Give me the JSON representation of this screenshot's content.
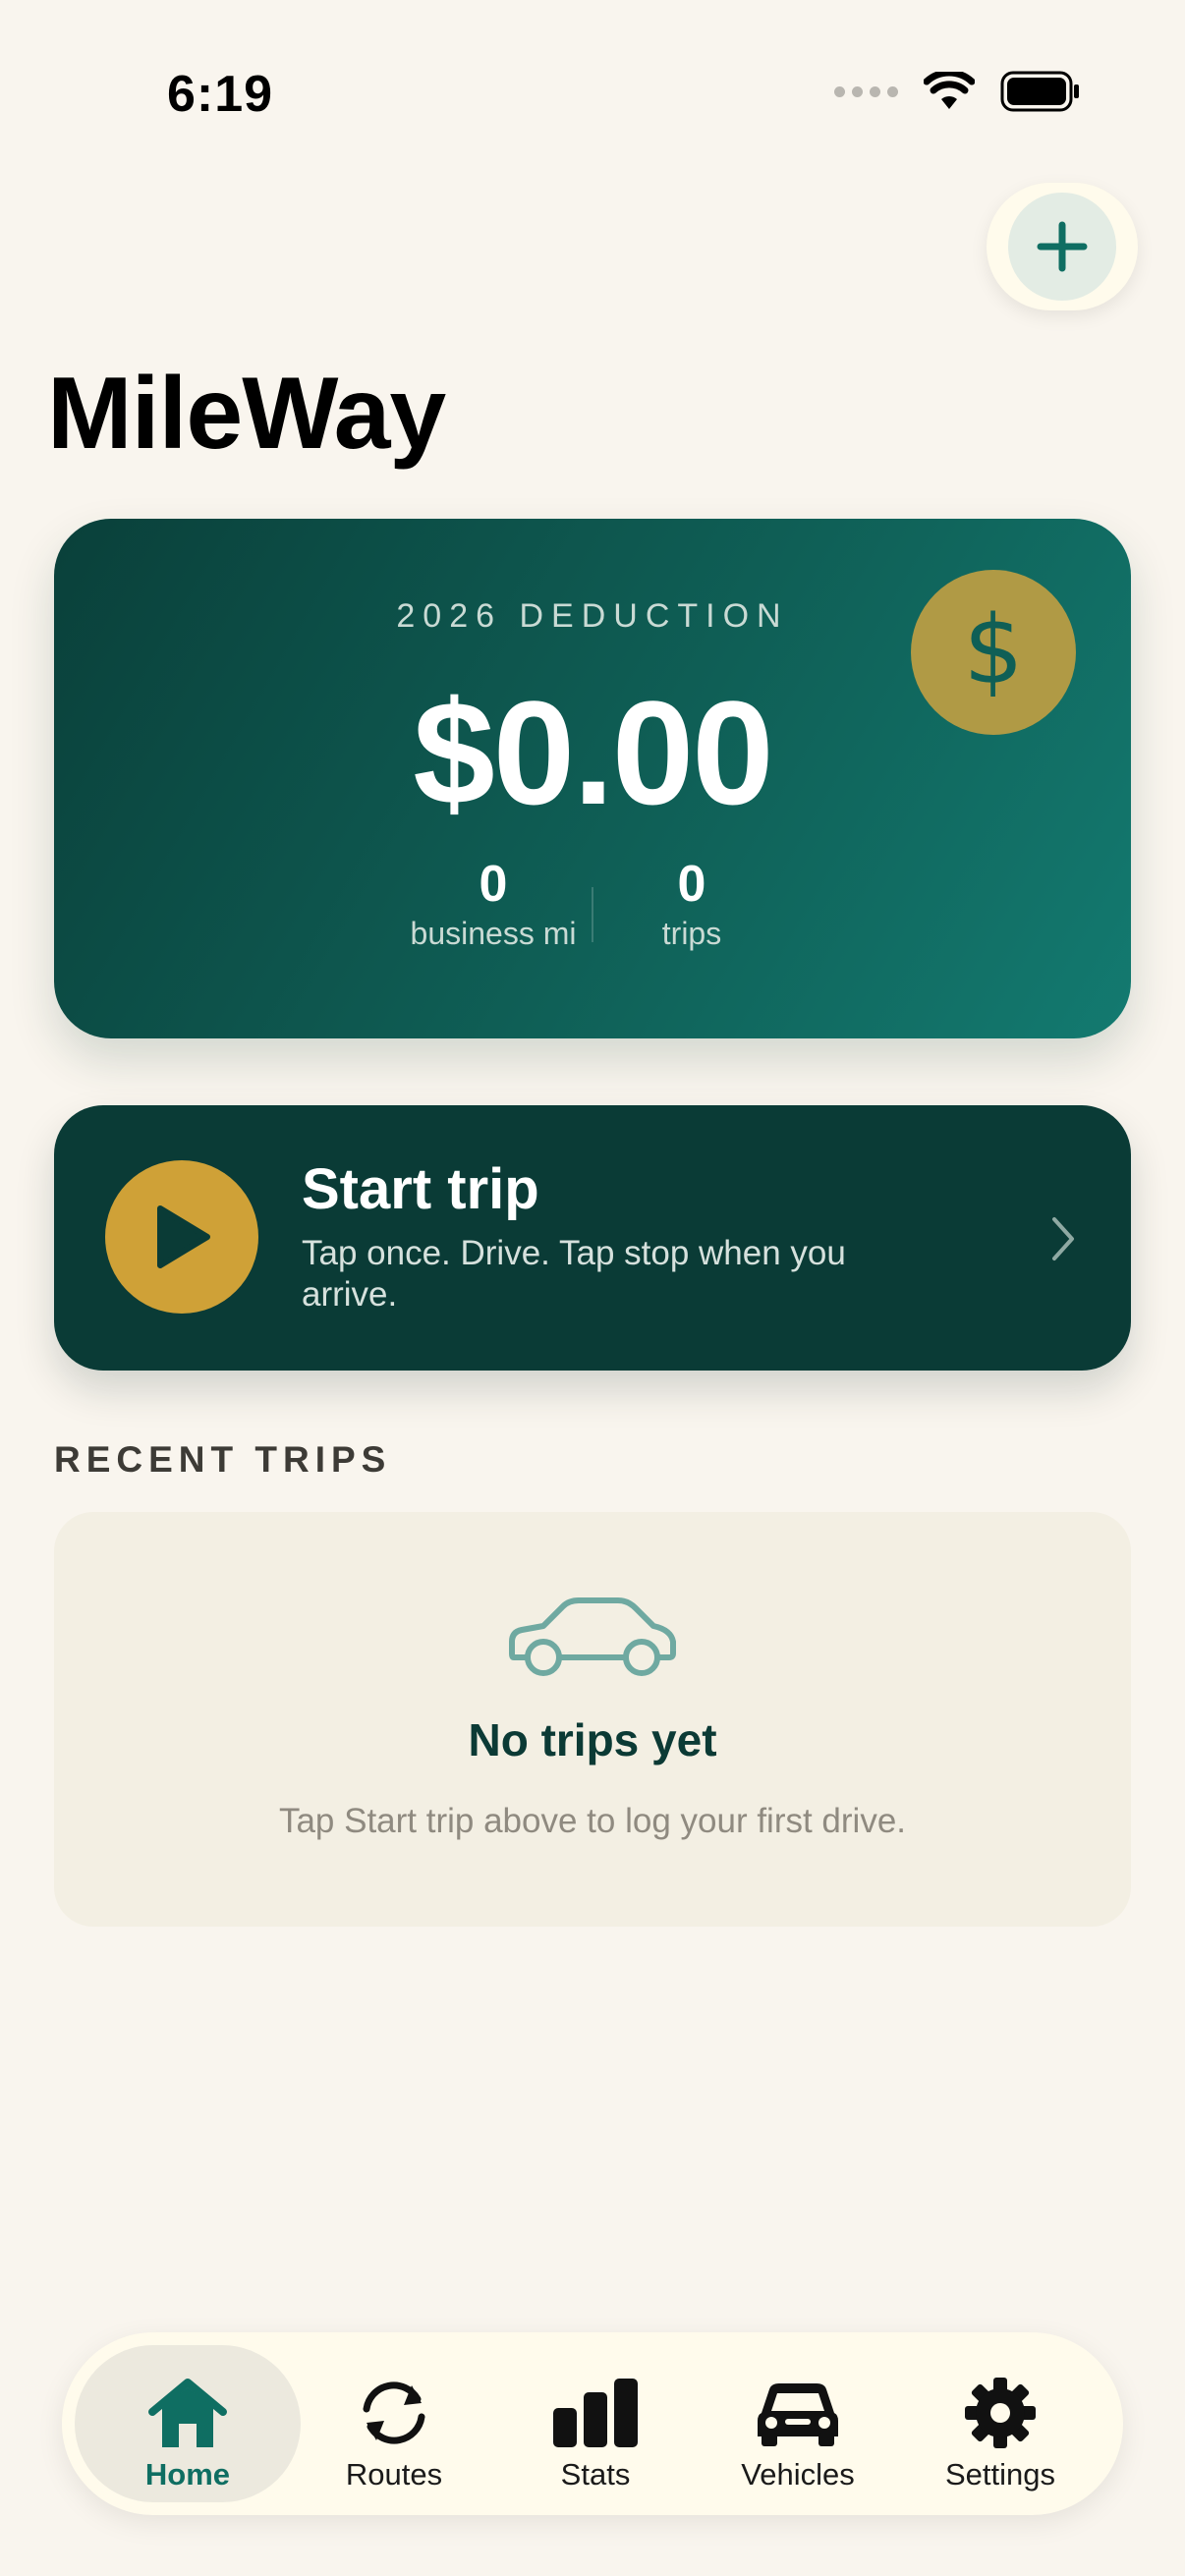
{
  "status_bar": {
    "time": "6:19"
  },
  "header": {
    "title": "MileWay"
  },
  "deduction_card": {
    "label": "2026 DEDUCTION",
    "amount": "$0.00",
    "business_miles_value": "0",
    "business_miles_label": "business mi",
    "trips_value": "0",
    "trips_label": "trips"
  },
  "start_trip": {
    "title": "Start trip",
    "subtitle": "Tap once. Drive. Tap stop when you arrive."
  },
  "recent_trips": {
    "header": "RECENT TRIPS",
    "empty_title": "No trips yet",
    "empty_subtitle": "Tap Start trip above to log your first drive."
  },
  "tab_bar": {
    "tabs": [
      {
        "label": "Home",
        "icon": "house-icon",
        "active": true
      },
      {
        "label": "Routes",
        "icon": "refresh-icon",
        "active": false
      },
      {
        "label": "Stats",
        "icon": "bar-chart-icon",
        "active": false
      },
      {
        "label": "Vehicles",
        "icon": "car-icon",
        "active": false
      },
      {
        "label": "Settings",
        "icon": "gear-icon",
        "active": false
      }
    ]
  },
  "colors": {
    "background": "#f9f5ee",
    "card_teal": "#0f5f56",
    "dark_teal": "#0a3b36",
    "gold": "#cfa137",
    "accent_teal": "#0f6e62"
  }
}
